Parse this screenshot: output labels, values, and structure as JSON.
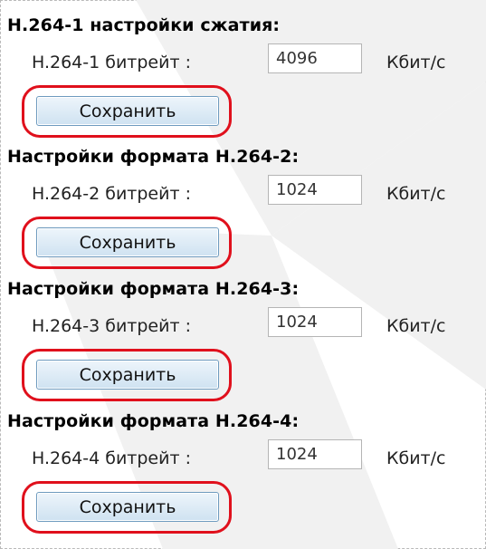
{
  "sections": [
    {
      "heading": "H.264-1 настройки сжатия:",
      "label": "H.264-1 битрейт :",
      "value": "4096",
      "unit": "Кбит/с",
      "button": "Сохранить"
    },
    {
      "heading": "Настройки формата H.264-2:",
      "label": "H.264-2 битрейт :",
      "value": "1024",
      "unit": "Кбит/с",
      "button": "Сохранить"
    },
    {
      "heading": "Настройки формата H.264-3:",
      "label": "H.264-3 битрейт :",
      "value": "1024",
      "unit": "Кбит/с",
      "button": "Сохранить"
    },
    {
      "heading": "Настройки формата H.264-4:",
      "label": "H.264-4 битрейт :",
      "value": "1024",
      "unit": "Кбит/с",
      "button": "Сохранить"
    }
  ],
  "colors": {
    "highlight": "#e0101c",
    "button_border": "#6e9bbf",
    "watermark": "#f1f1f1"
  }
}
